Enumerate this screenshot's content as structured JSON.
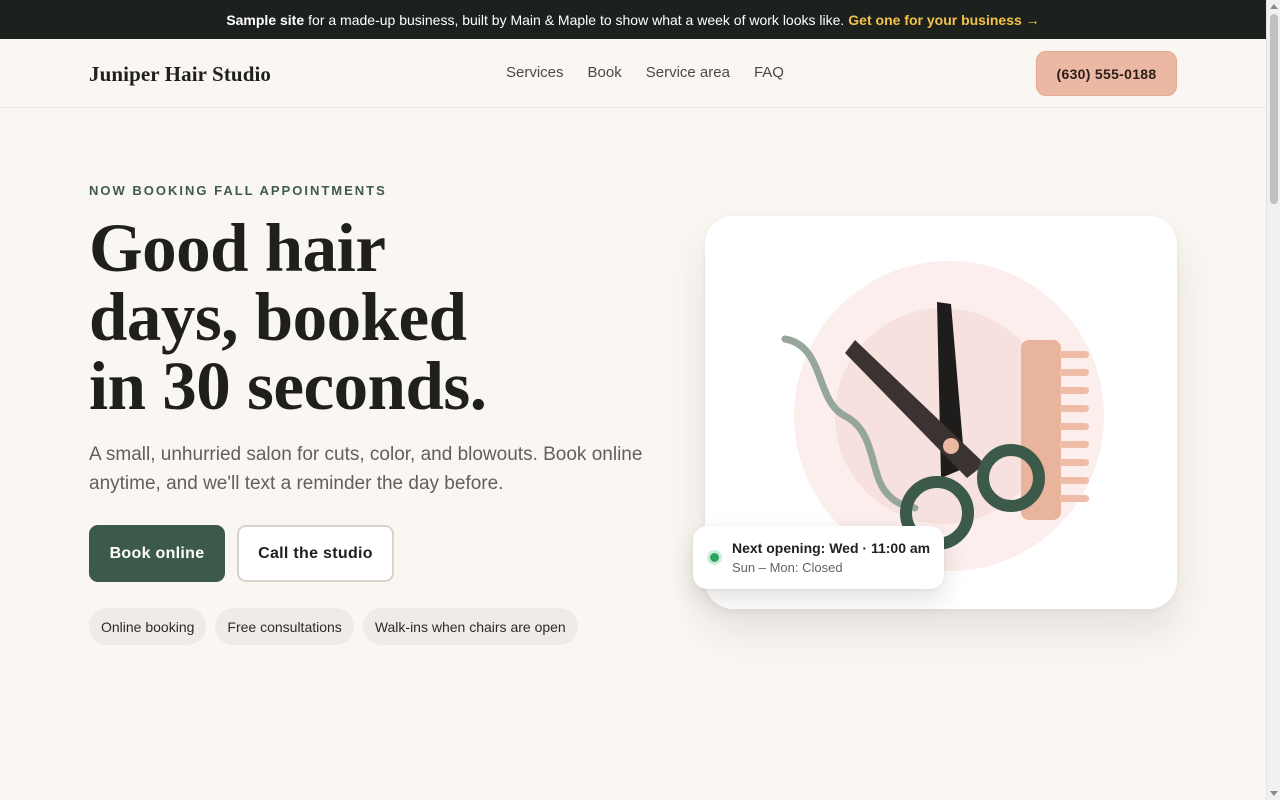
{
  "announcement": {
    "lead": "Sample site",
    "text": "for a made-up business, built by Main & Maple to show what a week of work looks like.",
    "link": "Get one for your business →"
  },
  "header": {
    "logo": "Juniper Hair Studio",
    "nav": [
      "Services",
      "Book",
      "Service area",
      "FAQ"
    ],
    "phone": "(630) 555-0188"
  },
  "hero": {
    "eyebrow": "NOW BOOKING FALL APPOINTMENTS",
    "headline_lines": [
      "Good hair",
      "days, booked",
      "in 30 seconds."
    ],
    "lede": "A small, unhurried salon for cuts, color, and blowouts. Book online anytime, and we'll text a reminder the day before.",
    "primary_cta": "Book online",
    "secondary_cta": "Call the studio",
    "chips": [
      "Online booking",
      "Free consultations",
      "Walk-ins when chairs are open"
    ]
  },
  "opening": {
    "title": "Next opening: Wed · 11:00 am",
    "subtitle": "Sun – Mon: Closed"
  },
  "colors": {
    "accent_green": "#3c5a4a",
    "accent_peach": "#ebb8a3",
    "announce_bg": "#1c211e",
    "link_yellow": "#f2c24b",
    "status_green": "#2fa35f"
  },
  "icons": {
    "illustration": "scissors-comb-illustration",
    "status": "status-dot-icon",
    "scroll_up": "scroll-up-arrow-icon",
    "scroll_down": "scroll-down-arrow-icon"
  }
}
